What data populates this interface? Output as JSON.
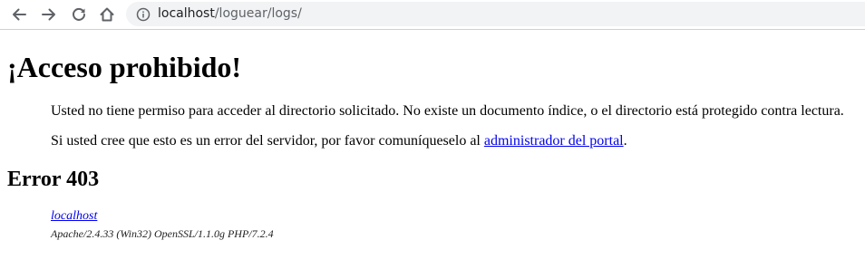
{
  "browser": {
    "url_host": "localhost",
    "url_path": "/loguear/logs/",
    "icons": [
      "back-icon",
      "forward-icon",
      "reload-icon",
      "home-icon",
      "info-icon"
    ]
  },
  "page": {
    "heading": "¡Acceso prohibido!",
    "paragraph1": "Usted no tiene permiso para acceder al directorio solicitado. No existe un documento índice, o el directorio está protegido contra lectura.",
    "paragraph2_before": "Si usted cree que esto es un error del servidor, por favor comuníqueselo al ",
    "paragraph2_link": "administrador del portal",
    "paragraph2_after": ".",
    "error_title": "Error 403",
    "footer_host_link": "localhost",
    "footer_server": "Apache/2.4.33 (Win32) OpenSSL/1.1.0g PHP/7.2.4"
  },
  "colors": {
    "link": "#0000ee",
    "omnibox_bg": "#f1f3f4",
    "icon": "#5f6368"
  }
}
